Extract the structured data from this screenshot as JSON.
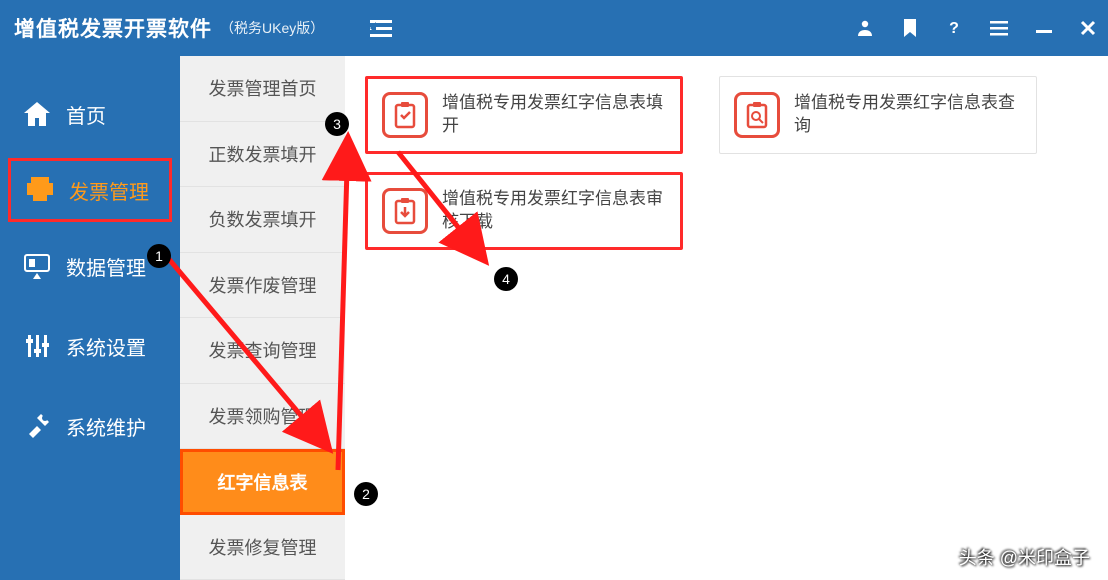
{
  "header": {
    "title": "增值税发票开票软件",
    "sub": "（税务UKey版）"
  },
  "sidebar": {
    "items": [
      {
        "label": "首页",
        "icon": "home-icon"
      },
      {
        "label": "发票管理",
        "icon": "printer-icon"
      },
      {
        "label": "数据管理",
        "icon": "data-icon"
      },
      {
        "label": "系统设置",
        "icon": "sliders-icon"
      },
      {
        "label": "系统维护",
        "icon": "tools-icon"
      }
    ]
  },
  "submenu": {
    "items": [
      {
        "label": "发票管理首页"
      },
      {
        "label": "正数发票填开"
      },
      {
        "label": "负数发票填开"
      },
      {
        "label": "发票作废管理"
      },
      {
        "label": "发票查询管理"
      },
      {
        "label": "发票领购管理"
      },
      {
        "label": "红字信息表"
      },
      {
        "label": "发票修复管理"
      }
    ],
    "activeIndex": 6
  },
  "content": {
    "cards": [
      {
        "label": "增值税专用发票红字信息表填开",
        "highlight": true
      },
      {
        "label": "增值税专用发票红字信息表查询",
        "highlight": false
      },
      {
        "label": "增值税专用发票红字信息表审核下载",
        "highlight": true
      }
    ]
  },
  "annotations": {
    "badges": [
      "1",
      "2",
      "3",
      "4"
    ]
  },
  "watermark": "头条 @米印盒子",
  "colors": {
    "primary": "#2770b3",
    "accent": "#ff8c1a",
    "highlight": "#ff2a2a"
  }
}
